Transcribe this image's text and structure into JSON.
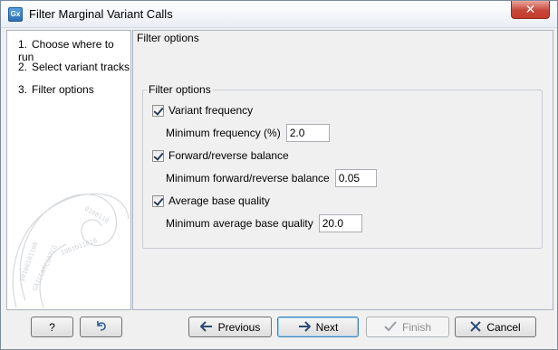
{
  "window": {
    "title": "Filter Marginal Variant Calls",
    "app_icon_text": "Gx",
    "close_symbol": "✕"
  },
  "steps": [
    {
      "num": "1.",
      "label": "Choose where to run"
    },
    {
      "num": "2.",
      "label": "Select variant tracks"
    },
    {
      "num": "3.",
      "label": "Filter options"
    }
  ],
  "content": {
    "section_title": "Filter options",
    "group_title": "Filter options",
    "options": [
      {
        "checkbox_label": "Variant frequency",
        "checked": true,
        "field_label": "Minimum frequency (%)",
        "value": "2.0"
      },
      {
        "checkbox_label": "Forward/reverse balance",
        "checked": true,
        "field_label": "Minimum forward/reverse balance",
        "value": "0.05"
      },
      {
        "checkbox_label": "Average base quality",
        "checked": true,
        "field_label": "Minimum average base quality",
        "value": "20.0"
      }
    ]
  },
  "buttons": {
    "help": "?",
    "reset_icon": "reset-icon",
    "previous": {
      "label": "Previous",
      "icon": "arrow-left-icon"
    },
    "next": {
      "label": "Next",
      "icon": "arrow-right-icon"
    },
    "finish": {
      "label": "Finish",
      "icon": "checkmark-icon"
    },
    "cancel": {
      "label": "Cancel",
      "icon": "x-icon"
    }
  },
  "colors": {
    "accent": "#3c7fb1",
    "close_red": "#c7463a"
  }
}
